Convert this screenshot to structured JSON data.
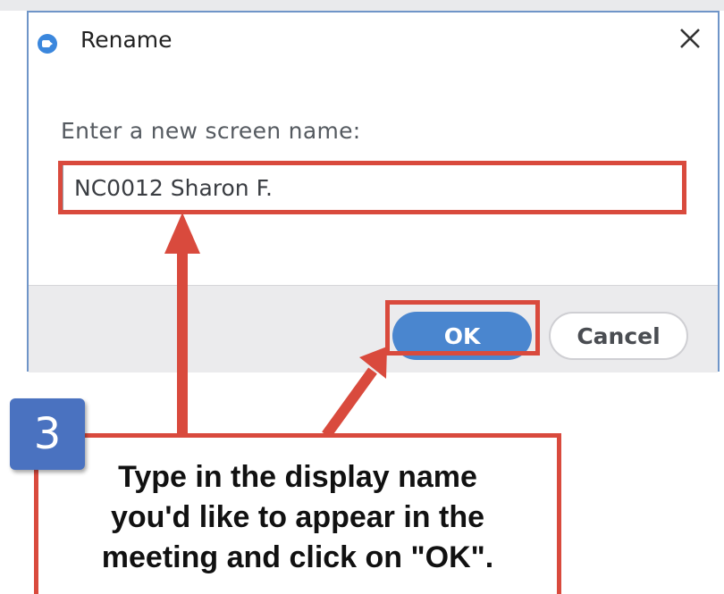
{
  "dialog": {
    "title": "Rename",
    "prompt": "Enter a new screen name:",
    "name_value": "NC0012 Sharon F.",
    "ok_label": "OK",
    "cancel_label": "Cancel",
    "app_icon": "zoom-camera-icon",
    "close_icon": "close-icon"
  },
  "annotation": {
    "step_number": "3",
    "instruction_lines": [
      "Type in the display name",
      "you'd like to appear in the",
      "meeting and click on \"OK\"."
    ]
  },
  "colors": {
    "highlight": "#d94a3d",
    "ok_button": "#4a86cf",
    "step_badge": "#4a72c0",
    "dialog_border": "#6f95c8"
  }
}
